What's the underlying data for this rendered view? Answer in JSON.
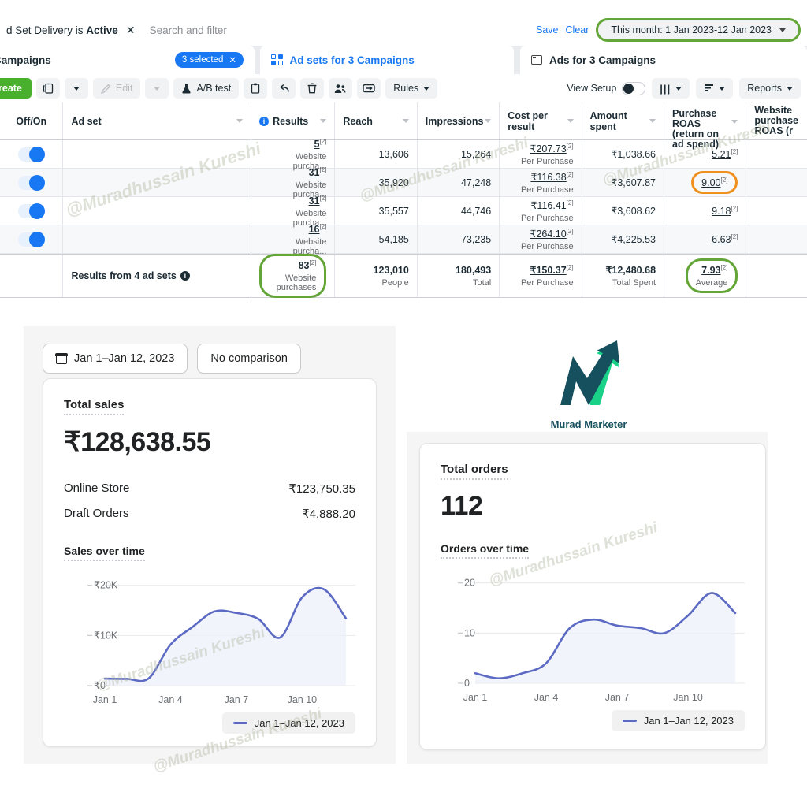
{
  "ads_manager": {
    "filter_chip": {
      "text": "d Set Delivery is ",
      "bold": "Active",
      "close": "✕"
    },
    "search_placeholder": "Search and filter",
    "save_label": "Save",
    "clear_label": "Clear",
    "date_range": "This month: 1 Jan 2023-12 Jan 2023",
    "tabs": [
      {
        "label": "Campaigns",
        "badge": "3 selected",
        "badge_close": "✕",
        "icon": "megaphone-icon"
      },
      {
        "label": "Ad sets for 3 Campaigns",
        "icon": "adsets-grid-icon"
      },
      {
        "label": "Ads for 3 Campaigns",
        "icon": "ads-window-icon"
      }
    ],
    "toolbar": {
      "create": "reate",
      "edit": "Edit",
      "ab_test": "A/B test",
      "rules": "Rules",
      "view_setup": "View Setup",
      "reports": "Reports",
      "columns_icon": "columns-icon",
      "breakdown_icon": "breakdown-icon"
    },
    "table": {
      "headers": [
        "Off/On",
        "Ad set",
        "Results",
        "Reach",
        "Impressions",
        "Cost per result",
        "Amount spent",
        "Purchase ROAS (return on ad spend)",
        "Website purchase ROAS (r"
      ],
      "rows": [
        {
          "toggle": "on",
          "ad_set": "",
          "results": "5",
          "results_sup": "[2]",
          "results_sub": "Website purcha...",
          "reach": "13,606",
          "impressions": "15,264",
          "cost_per_result": "₹207.73",
          "cpr_sup": "[2]",
          "cpr_sub": "Per Purchase",
          "amount_spent": "₹1,038.66",
          "roas": "5.21",
          "roas_sup": "[2]",
          "roas_highlight": "none"
        },
        {
          "toggle": "on",
          "ad_set": "",
          "results": "31",
          "results_sup": "[2]",
          "results_sub": "Website purcha...",
          "reach": "35,920",
          "impressions": "47,248",
          "cost_per_result": "₹116.38",
          "cpr_sup": "[2]",
          "cpr_sub": "Per Purchase",
          "amount_spent": "₹3,607.87",
          "roas": "9.00",
          "roas_sup": "[2]",
          "roas_highlight": "orange"
        },
        {
          "toggle": "on",
          "ad_set": "",
          "results": "31",
          "results_sup": "[2]",
          "results_sub": "Website purcha...",
          "reach": "35,557",
          "impressions": "44,746",
          "cost_per_result": "₹116.41",
          "cpr_sup": "[2]",
          "cpr_sub": "Per Purchase",
          "amount_spent": "₹3,608.62",
          "roas": "9.18",
          "roas_sup": "[2]",
          "roas_highlight": "none"
        },
        {
          "toggle": "on",
          "ad_set": "",
          "results": "16",
          "results_sup": "[2]",
          "results_sub": "Website purcha...",
          "reach": "54,185",
          "impressions": "73,235",
          "cost_per_result": "₹264.10",
          "cpr_sup": "[2]",
          "cpr_sub": "Per Purchase",
          "amount_spent": "₹4,225.53",
          "roas": "6.63",
          "roas_sup": "[2]",
          "roas_highlight": "none"
        }
      ],
      "total_row": {
        "label": "Results from 4 ad sets",
        "results": "83",
        "results_sup": "[2]",
        "results_sub": "Website purchases",
        "reach": "123,010",
        "reach_sub": "People",
        "impressions": "180,493",
        "impressions_sub": "Total",
        "cost_per_result": "₹150.37",
        "cpr_sup": "[2]",
        "cpr_sub": "Per Purchase",
        "amount_spent": "₹12,480.68",
        "spent_sub": "Total Spent",
        "roas": "7.93",
        "roas_sup": "[2]",
        "roas_sub": "Average"
      }
    }
  },
  "shopify": {
    "date_button": "Jan 1–Jan 12, 2023",
    "comparison_button": "No comparison",
    "total_sales": {
      "label": "Total sales",
      "value": "₹128,638.55",
      "breakdown": [
        {
          "label": "Online Store",
          "value": "₹123,750.35"
        },
        {
          "label": "Draft Orders",
          "value": "₹4,888.20"
        }
      ],
      "chart_title": "Sales over time",
      "legend": "Jan 1–Jan 12, 2023"
    },
    "total_orders": {
      "label": "Total orders",
      "value": "112",
      "chart_title": "Orders over time",
      "legend": "Jan 1–Jan 12, 2023"
    }
  },
  "logo": {
    "name": "Murad Marketer",
    "dark": "#15505c",
    "green": "#15d47f"
  },
  "watermarks": [
    "@Muradhussain Kureshi",
    "@Muradhussain Kureshi",
    "@Muradhussain Kureshi",
    "@Muradhussain Kureshi",
    "@Muradhussain Kureshi",
    "@Muradhussain Kureshi"
  ],
  "colors": {
    "fb_blue": "#1877f2",
    "create_green": "#48b02c",
    "highlight_green": "#63a537",
    "highlight_orange": "#f0901e",
    "chart_line": "#5c6ac4"
  },
  "chart_data": [
    {
      "type": "area",
      "title": "Sales over time",
      "xlabel": "",
      "ylabel": "",
      "ylim": [
        0,
        22000
      ],
      "yticks": [
        "₹0",
        "₹10K",
        "₹20K"
      ],
      "ytick_values": [
        0,
        10000,
        20000
      ],
      "xticks": [
        "Jan 1",
        "Jan 4",
        "Jan 7",
        "Jan 10"
      ],
      "grid": true,
      "legend": "Jan 1–Jan 12, 2023",
      "legend_position": "bottom-right",
      "x": [
        "Jan 1",
        "Jan 2",
        "Jan 3",
        "Jan 4",
        "Jan 5",
        "Jan 6",
        "Jan 7",
        "Jan 8",
        "Jan 9",
        "Jan 10",
        "Jan 11",
        "Jan 12"
      ],
      "values": [
        1400,
        1350,
        1450,
        8200,
        11700,
        14800,
        14500,
        13300,
        9600,
        17600,
        19200,
        13400
      ]
    },
    {
      "type": "area",
      "title": "Orders over time",
      "xlabel": "",
      "ylabel": "",
      "ylim": [
        0,
        22
      ],
      "yticks": [
        "0",
        "10",
        "20"
      ],
      "ytick_values": [
        0,
        10,
        20
      ],
      "xticks": [
        "Jan 1",
        "Jan 4",
        "Jan 7",
        "Jan 10"
      ],
      "grid": true,
      "legend": "Jan 1–Jan 12, 2023",
      "legend_position": "bottom-right",
      "x": [
        "Jan 1",
        "Jan 2",
        "Jan 3",
        "Jan 4",
        "Jan 5",
        "Jan 6",
        "Jan 7",
        "Jan 8",
        "Jan 9",
        "Jan 10",
        "Jan 11",
        "Jan 12"
      ],
      "values": [
        2,
        1,
        2,
        4,
        11,
        12.7,
        11.5,
        11,
        10,
        13.5,
        18,
        14
      ]
    }
  ]
}
